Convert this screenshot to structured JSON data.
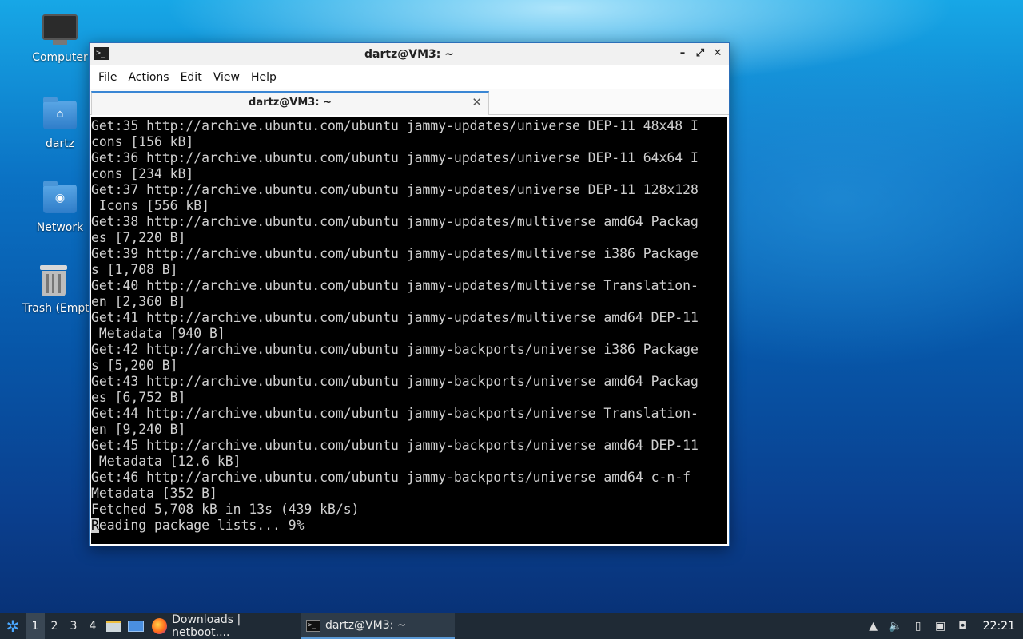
{
  "desktop": {
    "icons": [
      {
        "label": "Computer",
        "icon": "computer-icon"
      },
      {
        "label": "dartz",
        "icon": "home-folder-icon"
      },
      {
        "label": "Network",
        "icon": "network-folder-icon"
      },
      {
        "label": "Trash (Empt",
        "icon": "trash-icon"
      }
    ]
  },
  "window": {
    "title": "dartz@VM3: ~",
    "controls": {
      "minimize": "–",
      "maximize": "⤢",
      "close": "✕"
    },
    "menu": [
      "File",
      "Actions",
      "Edit",
      "View",
      "Help"
    ],
    "tab": {
      "title": "dartz@VM3: ~",
      "close": "✕"
    },
    "terminal_lines": [
      "Get:35 http://archive.ubuntu.com/ubuntu jammy-updates/universe DEP-11 48x48 I",
      "cons [156 kB]",
      "Get:36 http://archive.ubuntu.com/ubuntu jammy-updates/universe DEP-11 64x64 I",
      "cons [234 kB]",
      "Get:37 http://archive.ubuntu.com/ubuntu jammy-updates/universe DEP-11 128x128",
      " Icons [556 kB]",
      "Get:38 http://archive.ubuntu.com/ubuntu jammy-updates/multiverse amd64 Packag",
      "es [7,220 B]",
      "Get:39 http://archive.ubuntu.com/ubuntu jammy-updates/multiverse i386 Package",
      "s [1,708 B]",
      "Get:40 http://archive.ubuntu.com/ubuntu jammy-updates/multiverse Translation-",
      "en [2,360 B]",
      "Get:41 http://archive.ubuntu.com/ubuntu jammy-updates/multiverse amd64 DEP-11",
      " Metadata [940 B]",
      "Get:42 http://archive.ubuntu.com/ubuntu jammy-backports/universe i386 Package",
      "s [5,200 B]",
      "Get:43 http://archive.ubuntu.com/ubuntu jammy-backports/universe amd64 Packag",
      "es [6,752 B]",
      "Get:44 http://archive.ubuntu.com/ubuntu jammy-backports/universe Translation-",
      "en [9,240 B]",
      "Get:45 http://archive.ubuntu.com/ubuntu jammy-backports/universe amd64 DEP-11",
      " Metadata [12.6 kB]",
      "Get:46 http://archive.ubuntu.com/ubuntu jammy-backports/universe amd64 c-n-f",
      "Metadata [352 B]",
      "Fetched 5,708 kB in 13s (439 kB/s)"
    ],
    "prompt_cursor_char": "R",
    "prompt_rest": "eading package lists... 9%"
  },
  "taskbar": {
    "workspaces": [
      "1",
      "2",
      "3",
      "4"
    ],
    "active_workspace": "1",
    "tasks": [
      {
        "label": "Downloads | netboot....",
        "icon": "firefox-icon"
      },
      {
        "label": "dartz@VM3: ~",
        "icon": "terminal-icon"
      }
    ],
    "clock": "22:21"
  }
}
